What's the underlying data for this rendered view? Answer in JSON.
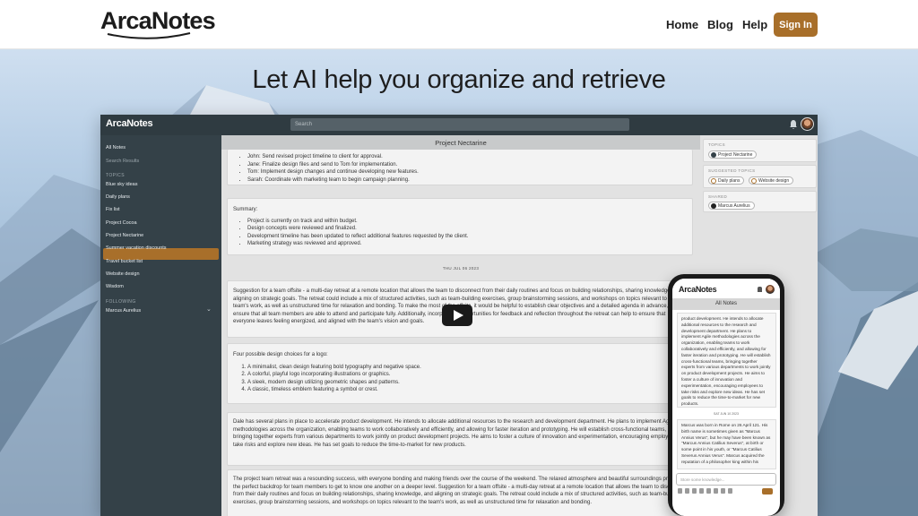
{
  "site": {
    "logo": "ArcaNotes",
    "nav": {
      "home": "Home",
      "blog": "Blog",
      "help": "Help",
      "signin": "Sign In"
    },
    "accent": "#a86f2a"
  },
  "hero": {
    "title": "Let AI help you organize and retrieve"
  },
  "app": {
    "logo": "ArcaNotes",
    "search_placeholder": "Search",
    "sidebar": {
      "all_notes": "All Notes",
      "search_results": "Search Results",
      "topics_heading": "TOPICS",
      "topics": [
        "Blue sky ideas",
        "Daily plans",
        "Fix list",
        "Project Cocoa",
        "Project Nectarine",
        "Summer vacation discounts",
        "Travel bucket list",
        "Website design",
        "Wisdom"
      ],
      "active_topic": "Project Nectarine",
      "following_heading": "FOLLOWING",
      "following": [
        "Marcus Aurelius"
      ]
    },
    "content": {
      "title": "Project Nectarine",
      "card1_items": [
        "John: Send revised project timeline to client for approval.",
        "Jane: Finalize design files and send to Tom for implementation.",
        "Tom: Implement design changes and continue developing new features.",
        "Sarah: Coordinate with marketing team to begin campaign planning."
      ],
      "card2_heading": "Summary:",
      "card2_items": [
        "Project is currently on track and within budget.",
        "Design concepts were reviewed and finalized.",
        "Development timeline has been updated to reflect additional features requested by the client.",
        "Marketing strategy was reviewed and approved."
      ],
      "date_separator": "THU JUL 06 2023",
      "card3_text": "Suggestion for a team offsite - a multi-day retreat at a remote location that allows the team to disconnect from their daily routines and focus on building relationships, sharing knowledge, and aligning on strategic goals. The retreat could include a mix of structured activities, such as team-building exercises, group brainstorming sessions, and workshops on topics relevant to the team's work, as well as unstructured time for relaxation and bonding. To make the most of the offsite, it would be helpful to establish clear objectives and a detailed agenda in advance, and to ensure that all team members are able to attend and participate fully. Additionally, incorporating opportunities for feedback and reflection throughout the retreat can help to ensure that everyone leaves feeling energized, and aligned with the team's vision and goals.",
      "card4_heading": "Four possible design choices for a logo:",
      "card4_items": [
        "A minimalist, clean design featuring bold typography and negative space.",
        "A colorful, playful logo incorporating illustrations or graphics.",
        "A sleek, modern design utilizing geometric shapes and patterns.",
        "A classic, timeless emblem featuring a symbol or crest."
      ],
      "card5_text": "Dale has several plans in place to accelerate product development. He intends to allocate additional resources to the research and development department. He plans to implement Agile methodologies across the organization, enabling teams to work collaboratively and efficiently, and allowing for faster iteration and prototyping. He will establish cross-functional teams, bringing together experts from various departments to work jointly on product development projects. He aims to foster a culture of innovation and experimentation, encouraging employees to take risks and explore new ideas. He has set goals to reduce the time-to-market for new products.",
      "card6_text": "The project team retreat was a resounding success, with everyone bonding and making friends over the course of the weekend. The relaxed atmosphere and beautiful surroundings provided the perfect backdrop for team members to get to know one another on a deeper level. Suggestion for a team offsite - a multi-day retreat at a remote location that allows the team to disconnect from their daily routines and focus on building relationships, sharing knowledge, and aligning on strategic goals. The retreat could include a mix of structured activities, such as team-building exercises, group brainstorming sessions, and workshops on topics relevant to the team's work, as well as unstructured time for relaxation and bonding."
    },
    "right_panel": {
      "topics_label": "TOPICS",
      "topics": [
        "Project Nectarine"
      ],
      "suggested_label": "SUGGESTED TOPICS",
      "suggested": [
        "Daily plans",
        "Website design"
      ],
      "shared_label": "SHARED",
      "shared": [
        "Marcus Aurelius"
      ]
    }
  },
  "phone": {
    "logo": "ArcaNotes",
    "header": "All Notes",
    "card1_text": "product development. He intends to allocate additional resources to the research and development department. He plans to implement Agile methodologies across the organization, enabling teams to work collaboratively and efficiently, and allowing for faster iteration and prototyping. He will establish cross-functional teams, bringing together experts from various departments to work jointly on product development projects. He aims to foster a culture of innovation and experimentation, encouraging employees to take risks and explore new ideas. He has set goals to reduce the time-to-market for new products.",
    "date_separator": "SAT JUN 10 2023",
    "card2_text": "Marcus was born in Rome on 26 April 121. His birth name is sometimes given as \"Marcus Annius Verus\", but he may have been known as \"Marcus Annius Catilius Severus\", at birth or some point in his youth, or \"Marcus Catilius Severus Annius Verus\". Marcus acquired the reputation of a philosopher king within his",
    "input_placeholder": "Store some knowledge..."
  }
}
